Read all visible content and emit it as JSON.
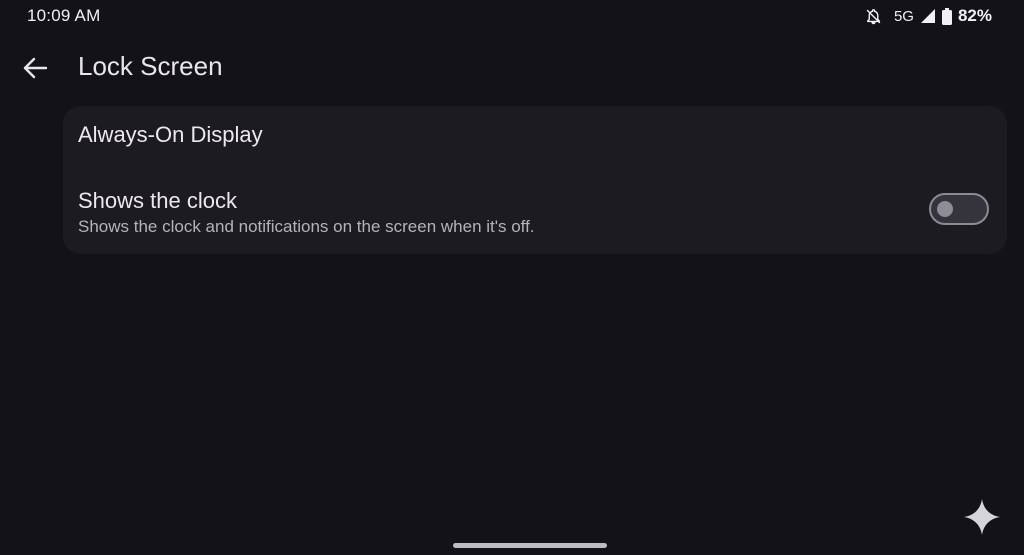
{
  "status_bar": {
    "time": "10:09 AM",
    "network": "5G",
    "battery": "82%",
    "icons": [
      "notifications-off-icon",
      "signal-icon",
      "battery-icon"
    ]
  },
  "header": {
    "back_icon": "arrow-back-icon",
    "title": "Lock Screen"
  },
  "card": {
    "header": "Always-On Display",
    "setting": {
      "title": "Shows the clock",
      "description": "Shows the clock and notifications on the screen when it's off.",
      "toggle_on": false
    }
  },
  "bottom": {
    "assistant_icon": "sparkle-icon"
  },
  "colors": {
    "background": "#121217",
    "card": "#1c1b21",
    "text_primary": "#ebe9ef",
    "text_secondary": "#b4b2ba",
    "toggle_border": "#8c8a93"
  }
}
